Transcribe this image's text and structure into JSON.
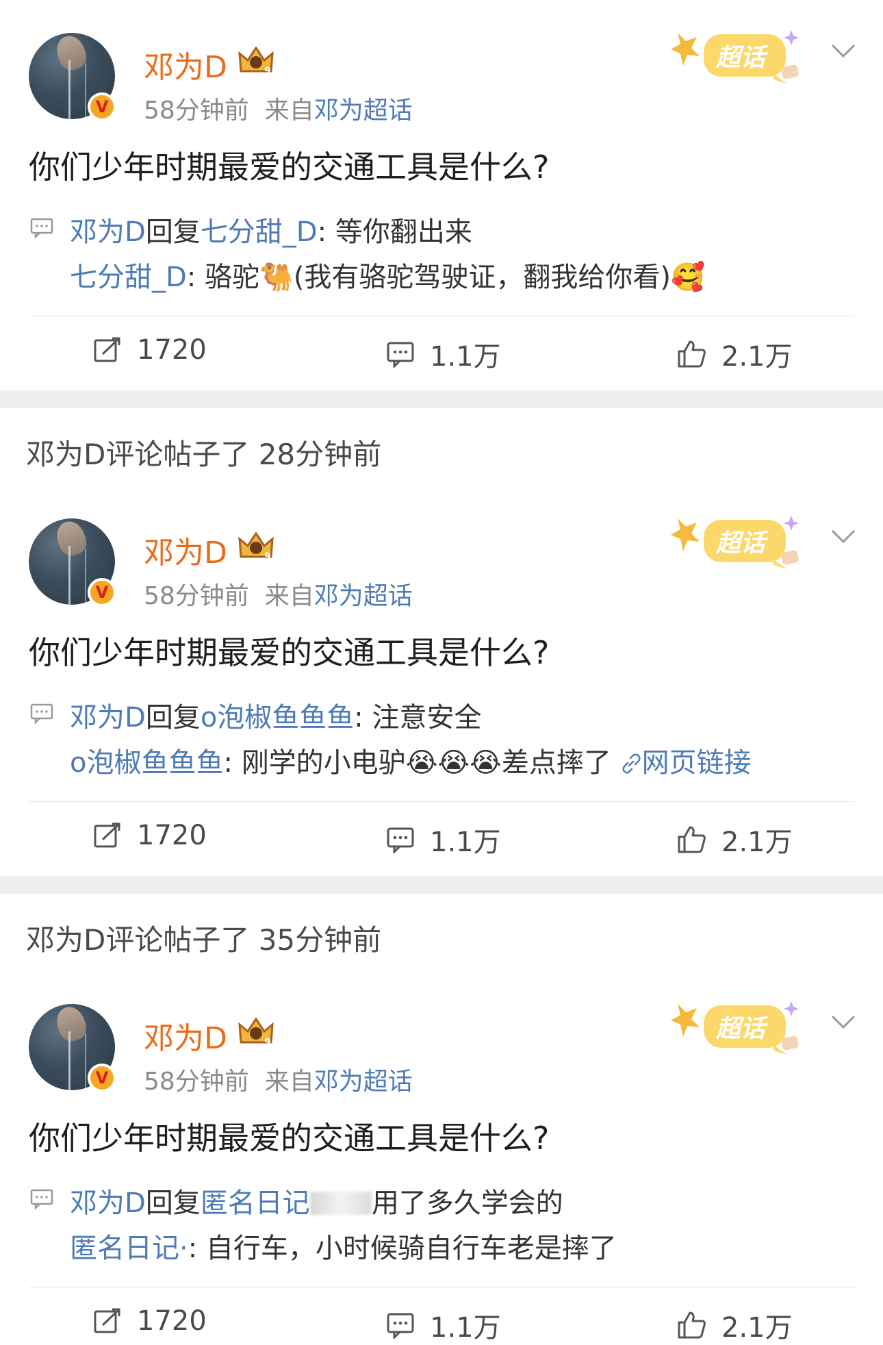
{
  "headers": [
    {
      "text": "邓为D评论帖子了 28分钟前"
    },
    {
      "text": "邓为D评论帖子了 35分钟前"
    }
  ],
  "posts": [
    {
      "username": "邓为D",
      "time": "58分钟前",
      "from_prefix": "来自",
      "source": "邓为超话",
      "tag_label": "超话",
      "content": "你们少年时期最爱的交通工具是什么?",
      "comment1": {
        "author": "邓为D",
        "reply_word": "回复",
        "target": "七分甜_D",
        "colon": ": ",
        "text": "等你翻出来"
      },
      "comment2": {
        "author": "七分甜_D",
        "colon": ": ",
        "text_a": "骆驼",
        "emoji_a": "🐫",
        "text_b": "(我有骆驼驾驶证，翻我给你看)",
        "emoji_b": "🥰"
      },
      "actions": {
        "repost": "1720",
        "comment": "1.1万",
        "like": "2.1万"
      }
    },
    {
      "username": "邓为D",
      "time": "58分钟前",
      "from_prefix": "来自",
      "source": "邓为超话",
      "tag_label": "超话",
      "content": "你们少年时期最爱的交通工具是什么?",
      "comment1": {
        "author": "邓为D",
        "reply_word": "回复",
        "target": "o泡椒鱼鱼鱼",
        "colon": ": ",
        "text": "注意安全"
      },
      "comment2": {
        "author": "o泡椒鱼鱼鱼",
        "colon": ": ",
        "text_a": "刚学的小电驴",
        "emoji_a": "😭😭😭",
        "text_b": "差点摔了",
        "link": "网页链接"
      },
      "actions": {
        "repost": "1720",
        "comment": "1.1万",
        "like": "2.1万"
      }
    },
    {
      "username": "邓为D",
      "time": "58分钟前",
      "from_prefix": "来自",
      "source": "邓为超话",
      "tag_label": "超话",
      "content": "你们少年时期最爱的交通工具是什么?",
      "comment1": {
        "author": "邓为D",
        "reply_word": "回复",
        "target": "匿名日记",
        "colon": "",
        "text": "用了多久学会的"
      },
      "comment2": {
        "author": "匿名日记·",
        "colon": ": ",
        "text_a": "自行车，小时候骑自行车老是摔了"
      },
      "actions": {
        "repost": "1720",
        "comment": "1.1万",
        "like": "2.1万"
      }
    }
  ],
  "colors": {
    "username": "#e96b18",
    "link": "#4e7bb6",
    "meta": "#8a8a8a",
    "separator": "#efefef"
  },
  "icons": [
    "crown-level-icon",
    "supertopic-tag-icon",
    "chevron-down-icon",
    "comment-bubble-icon",
    "repost-icon",
    "comment-icon",
    "like-icon",
    "link-icon",
    "verified-v-icon"
  ]
}
